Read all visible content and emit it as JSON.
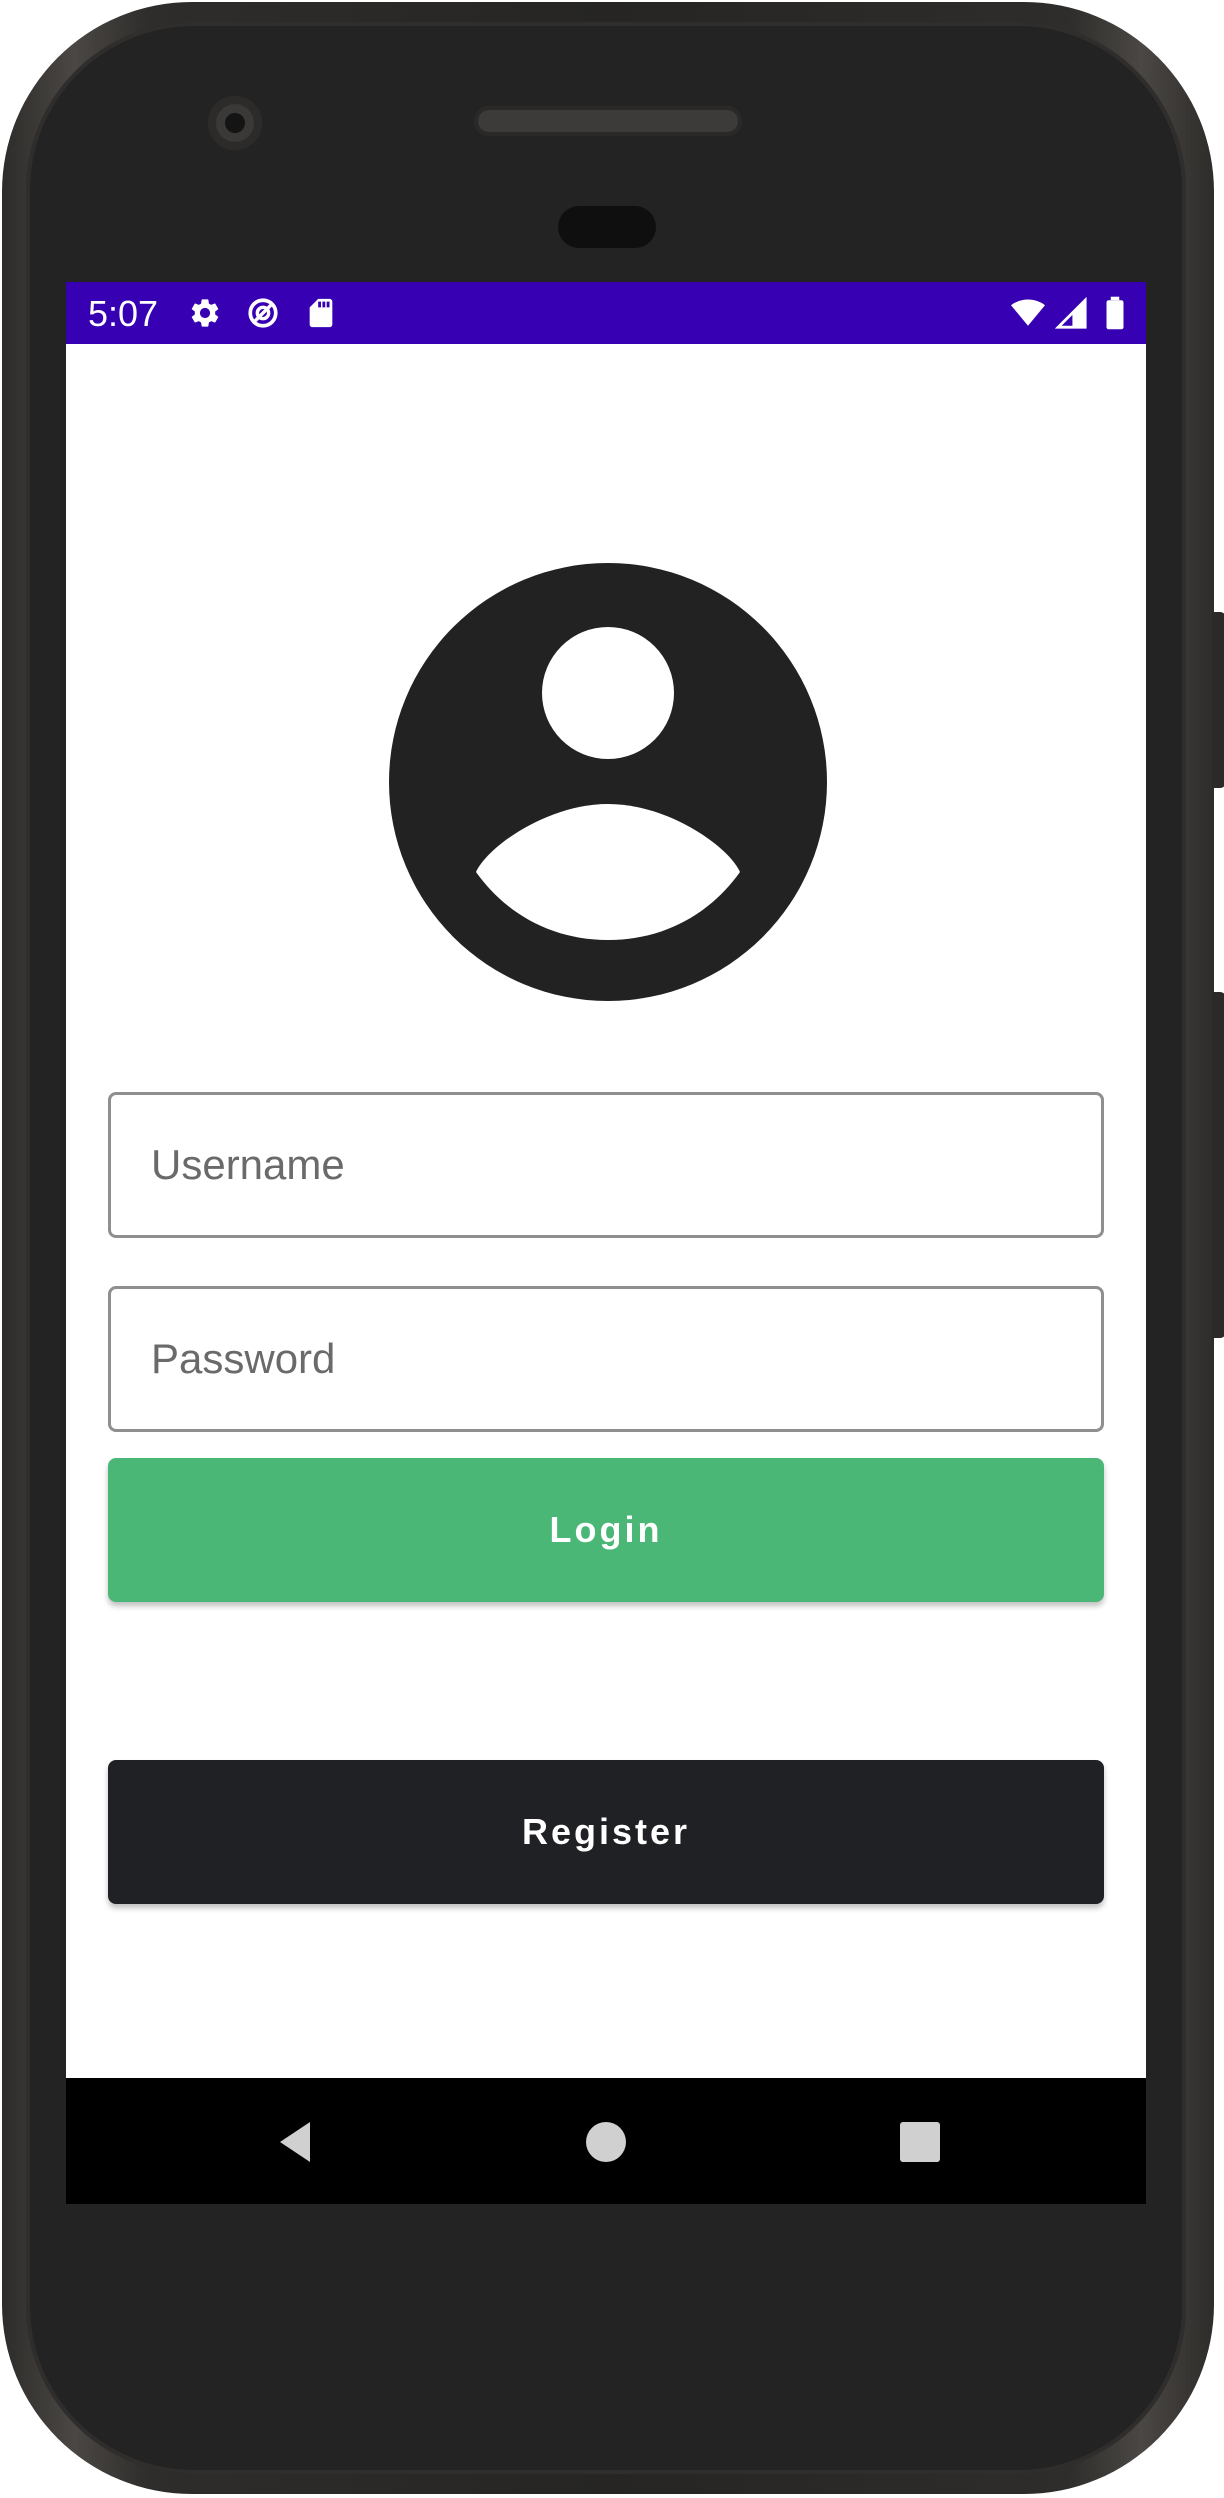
{
  "status_bar": {
    "time": "5:07",
    "left_icons": [
      "settings-icon",
      "sync-icon",
      "sd-card-icon"
    ],
    "right_icons": [
      "wifi-icon",
      "signal-icon",
      "battery-icon"
    ],
    "color": "#3700b3"
  },
  "login": {
    "avatar_icon": "account-circle-icon",
    "username_placeholder": "Username",
    "password_placeholder": "Password",
    "login_label": "Login",
    "register_label": "Register",
    "login_color": "#4ab776",
    "register_color": "#202124"
  },
  "nav_bar": {
    "icons": [
      "back-icon",
      "home-icon",
      "recents-icon"
    ]
  }
}
